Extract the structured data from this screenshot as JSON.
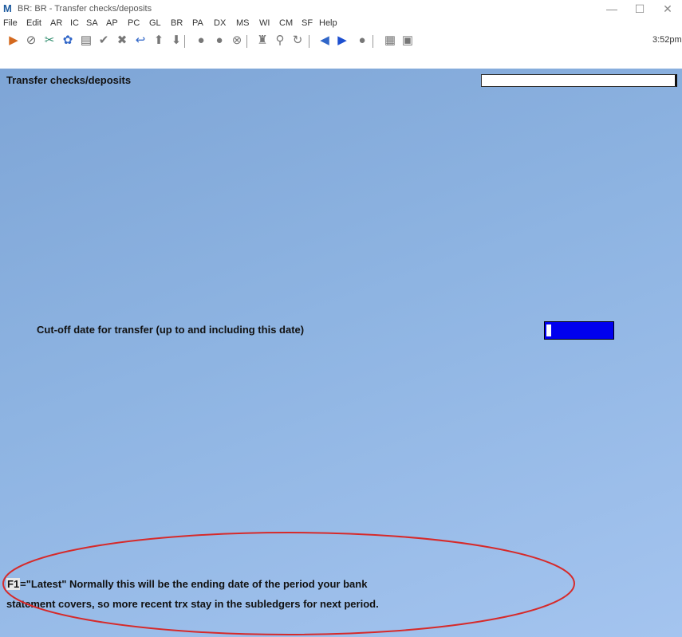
{
  "window": {
    "title": "BR: BR - Transfer checks/deposits",
    "logo_glyph": "M",
    "controls": [
      "—",
      "☐",
      "✕"
    ]
  },
  "menu": [
    "File",
    "Edit",
    "AR",
    "IC",
    "SA",
    "AP",
    "PC",
    "GL",
    "BR",
    "PA",
    "DX",
    "MS",
    "WI",
    "CM",
    "SF",
    "Help"
  ],
  "toolbar": {
    "clock": "3:52pm",
    "icons": [
      {
        "name": "exit-icon",
        "glyph": "▶",
        "color": "#d4691e"
      },
      {
        "name": "cancel-icon",
        "glyph": "⊘",
        "color": "#666"
      },
      {
        "name": "tools-icon",
        "glyph": "✂",
        "color": "#2a8a6a"
      },
      {
        "name": "settings-icon",
        "glyph": "✿",
        "color": "#3066c8"
      },
      {
        "name": "print-icon",
        "glyph": "▤",
        "color": "#666"
      },
      {
        "name": "check-icon",
        "glyph": "✔",
        "color": "#777"
      },
      {
        "name": "delete-icon",
        "glyph": "✖",
        "color": "#777"
      },
      {
        "name": "undo-icon",
        "glyph": "↩",
        "color": "#3066c8"
      },
      {
        "name": "up-arrow-icon",
        "glyph": "⬆",
        "color": "#777"
      },
      {
        "name": "down-arrow-icon",
        "glyph": "⬇",
        "color": "#777"
      },
      {
        "name": "circle1-icon",
        "glyph": "●",
        "color": "#777"
      },
      {
        "name": "circle2-icon",
        "glyph": "●",
        "color": "#777"
      },
      {
        "name": "circle3-icon",
        "glyph": "⊗",
        "color": "#777"
      },
      {
        "name": "binoculars-icon",
        "glyph": "♜",
        "color": "#777"
      },
      {
        "name": "zoom-icon",
        "glyph": "⚲",
        "color": "#777"
      },
      {
        "name": "refresh-icon",
        "glyph": "↻",
        "color": "#777"
      },
      {
        "name": "prev-icon",
        "glyph": "◀",
        "color": "#3066c8"
      },
      {
        "name": "next-icon",
        "glyph": "▶",
        "color": "#1d4fd0"
      },
      {
        "name": "user-icon",
        "glyph": "●",
        "color": "#777"
      },
      {
        "name": "calculator-icon",
        "glyph": "▦",
        "color": "#777"
      },
      {
        "name": "clipboard-icon",
        "glyph": "▣",
        "color": "#777"
      }
    ]
  },
  "screen": {
    "title": "Transfer checks/deposits",
    "prompt_label": "Cut-off date for transfer (up to and including this date)",
    "help_key": "F1",
    "help_line1": "=\"Latest\"   Normally this will be the ending date of the period your bank",
    "help_line2": "statement covers, so more recent trx stay in the subledgers for next period."
  },
  "colors": {
    "input_bg": "#0000ee",
    "annotation": "#d62a2a"
  }
}
